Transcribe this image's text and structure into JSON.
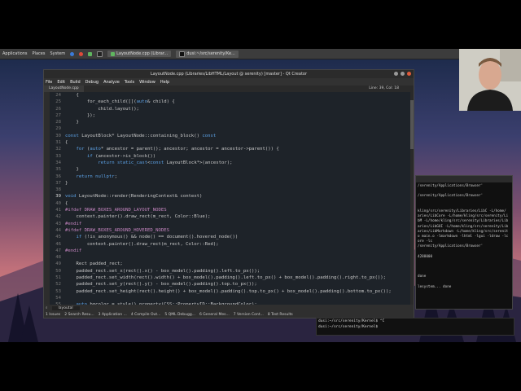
{
  "panel": {
    "applications": "Applications",
    "places": "Places",
    "system": "System",
    "task1": "LayoutNode.cpp (Librar...",
    "task2": "dusi:~/src/serenity/Ke..."
  },
  "window": {
    "title": "LayoutNode.cpp (Libraries/LibHTML/Layout @ serenity) [master] - Qt Creator",
    "tab": "LayoutNode.cpp",
    "cursor_pos": "Line: 39, Col: 18"
  },
  "menu": [
    "File",
    "Edit",
    "Build",
    "Debug",
    "Analyze",
    "Tools",
    "Window",
    "Help"
  ],
  "code": [
    {
      "n": "24",
      "t": "    {"
    },
    {
      "n": "25",
      "t": "        for_each_child([](auto& child) {"
    },
    {
      "n": "26",
      "t": "            child.layout();"
    },
    {
      "n": "27",
      "t": "        });"
    },
    {
      "n": "28",
      "t": "    }"
    },
    {
      "n": "29",
      "t": ""
    },
    {
      "n": "30",
      "t": "const LayoutBlock* LayoutNode::containing_block() const"
    },
    {
      "n": "31",
      "t": "{"
    },
    {
      "n": "32",
      "t": "    for (auto* ancestor = parent(); ancestor; ancestor = ancestor->parent()) {"
    },
    {
      "n": "33",
      "t": "        if (ancestor->is_block())"
    },
    {
      "n": "34",
      "t": "            return static_cast<const LayoutBlock*>(ancestor);"
    },
    {
      "n": "35",
      "t": "    }"
    },
    {
      "n": "36",
      "t": "    return nullptr;"
    },
    {
      "n": "37",
      "t": "}"
    },
    {
      "n": "38",
      "t": ""
    },
    {
      "n": "39",
      "t": "void LayoutNode::render(RenderingContext& context)"
    },
    {
      "n": "40",
      "t": "{"
    },
    {
      "n": "41",
      "t": "#ifdef DRAW_BOXES_AROUND_LAYOUT_NODES"
    },
    {
      "n": "42",
      "t": "    context.painter().draw_rect(m_rect, Color::Blue);"
    },
    {
      "n": "43",
      "t": "#endif"
    },
    {
      "n": "44",
      "t": "#ifdef DRAW_BOXES_AROUND_HOVERED_NODES"
    },
    {
      "n": "45",
      "t": "    if (!is_anonymous() && node() == document().hovered_node())"
    },
    {
      "n": "46",
      "t": "        context.painter().draw_rect(m_rect, Color::Red);"
    },
    {
      "n": "47",
      "t": "#endif"
    },
    {
      "n": "48",
      "t": ""
    },
    {
      "n": "49",
      "t": "    Rect padded_rect;"
    },
    {
      "n": "50",
      "t": "    padded_rect.set_x(rect().x() - box_model().padding().left.to_px());"
    },
    {
      "n": "51",
      "t": "    padded_rect.set_width(rect().width() + box_model().padding().left.to_px() + box_model().padding().right.to_px());"
    },
    {
      "n": "52",
      "t": "    padded_rect.set_y(rect().y() - box_model().padding().top.to_px());"
    },
    {
      "n": "53",
      "t": "    padded_rect.set_height(rect().height() + box_model().padding().top.to_px() + box_model().padding().bottom.to_px());"
    },
    {
      "n": "54",
      "t": ""
    },
    {
      "n": "55",
      "t": "    auto bgcolor = style().property(CSS::PropertyID::BackgroundColor);"
    }
  ],
  "bottom": {
    "search_placeholder": "layoutal",
    "panes": [
      "1 Issues",
      "2 Search Resu...",
      "3 Application ...",
      "4 Compile Out...",
      "5 QML Debugg...",
      "6 General Mes...",
      "7 Version Cont...",
      "8 Test Results"
    ]
  },
  "term2_lines": [
    "/serenity/Applications/Browser'",
    "",
    "/serenity/Applications/Browser'",
    "",
    "",
    "kling/src/serenity/Libraries/LibC -L/home/",
    "aries/LibCore -L/home/kling/src/serenity/Li",
    "bM -L/home/kling/src/serenity/Libraries/Lib",
    "aries/LibGUI -L/home/kling/src/serenity/Lib",
    "aries/LibMarkdown -L/home/kling/src/serenit",
    "o main.o -lmarkdown -lhtml -lgui -ldraw -lc",
    "ore -lc",
    "/serenity/Applications/Browser'",
    "",
    "4288000",
    "",
    "",
    "",
    "done",
    "",
    "lesystem... done"
  ],
  "terminal": [
    "dusi:~/src/serenity/Kernel$ ^C",
    "dusi:~/src/serenity/Kernel$ "
  ]
}
